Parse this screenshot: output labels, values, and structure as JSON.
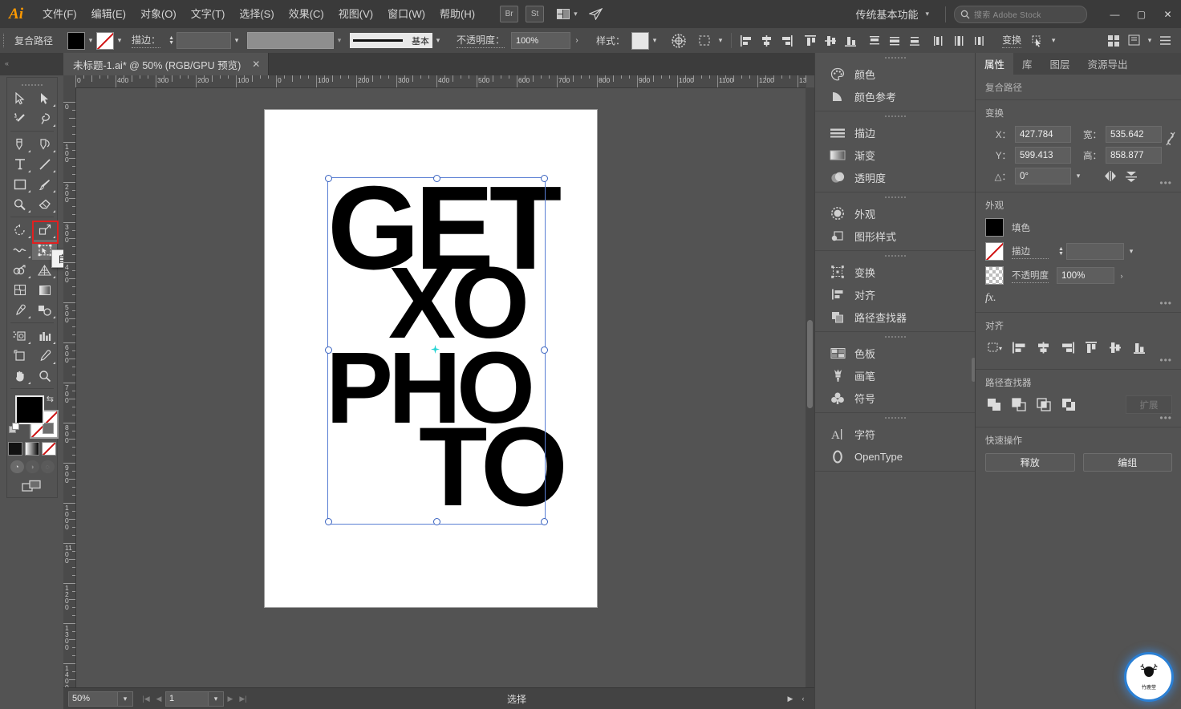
{
  "app": {
    "logo": "Ai",
    "menus": [
      "文件(F)",
      "编辑(E)",
      "对象(O)",
      "文字(T)",
      "选择(S)",
      "效果(C)",
      "视图(V)",
      "窗口(W)",
      "帮助(H)"
    ],
    "app_shortcuts": [
      "Br",
      "St"
    ],
    "workspace": "传统基本功能",
    "search_placeholder": "搜索 Adobe Stock",
    "window_buttons": [
      "minimize",
      "maximize",
      "close"
    ]
  },
  "control_bar": {
    "object_type": "复合路径",
    "fill_swatch": "#000000",
    "stroke_swatch": "none",
    "stroke_label": "描边：",
    "stroke_weight": "",
    "stroke_profile": "",
    "brush_definition": "基本",
    "opacity_label": "不透明度：",
    "opacity_value": "100%",
    "style_label": "样式：",
    "style_swatch": "#d9d9d9",
    "transform_label": "变换",
    "align_icons": [
      "align-left-icon",
      "align-center-h-icon",
      "align-right-icon",
      "align-top-icon",
      "align-center-v-icon",
      "align-bottom-icon",
      "distribute-top-icon",
      "distribute-center-v-icon",
      "distribute-bottom-icon",
      "distribute-left-icon",
      "distribute-center-h-icon",
      "distribute-right-icon"
    ]
  },
  "tab_bar": {
    "document_tab": "未标题-1.ai* @ 50% (RGB/GPU 预览)",
    "close_glyph": "✕"
  },
  "toolbar": {
    "tools": [
      [
        "selection-tool",
        "direct-selection-tool"
      ],
      [
        "magic-wand-tool",
        "lasso-tool"
      ],
      [
        "pen-tool",
        "curvature-tool"
      ],
      [
        "type-tool",
        "line-segment-tool"
      ],
      [
        "rectangle-tool",
        "paintbrush-tool"
      ],
      [
        "shaper-tool",
        "eraser-tool"
      ],
      [
        "rotate-tool",
        "scale-tool"
      ],
      [
        "width-tool",
        "free-transform-tool"
      ],
      [
        "shape-builder-tool",
        "perspective-grid-tool"
      ],
      [
        "mesh-tool",
        "gradient-tool"
      ],
      [
        "eyedropper-tool",
        "blend-tool"
      ],
      [
        "symbol-sprayer-tool",
        "column-graph-tool"
      ],
      [
        "artboard-tool",
        "slice-tool"
      ],
      [
        "hand-tool",
        "zoom-tool"
      ]
    ],
    "selected_tool": "free-transform-tool",
    "fill_color": "#000000",
    "stroke_color": "none",
    "color_modes": [
      "solid-color",
      "gradient",
      "none"
    ],
    "draw_modes": [
      "draw-normal",
      "draw-behind",
      "draw-inside"
    ],
    "screen_mode": "change-screen-mode"
  },
  "tool_flyout": {
    "items": [
      "constrain-tool",
      "free-transform-tool",
      "perspective-distort-tool",
      "free-distort-tool"
    ],
    "selected_index": 1
  },
  "tooltip": {
    "text": "自由变换工具 (E)"
  },
  "canvas": {
    "ruler_h_labels": [
      "0",
      "400",
      "300",
      "200",
      "100",
      "0",
      "100",
      "200",
      "300",
      "400",
      "500",
      "600",
      "700",
      "800",
      "900",
      "1000",
      "1100",
      "1200",
      "130"
    ],
    "ruler_v_labels": [
      "0",
      "100",
      "200",
      "300",
      "400",
      "500",
      "600",
      "700",
      "800",
      "900",
      "1000",
      "1100",
      "1200",
      "1300",
      "1400"
    ],
    "artwork_lines": [
      "GET",
      "XO",
      "PHO",
      "TO"
    ],
    "artwork_color": "#000000",
    "artboard_background": "#ffffff",
    "selection_color": "#5a7fd4"
  },
  "status_bar": {
    "zoom": "50%",
    "page": "1",
    "status": "选择"
  },
  "dock": {
    "groups": [
      {
        "items": [
          {
            "icon": "color-palette-icon",
            "label": "颜色"
          },
          {
            "icon": "color-guide-icon",
            "label": "颜色参考"
          }
        ]
      },
      {
        "items": [
          {
            "icon": "stroke-icon",
            "label": "描边"
          },
          {
            "icon": "gradient-icon",
            "label": "渐变"
          },
          {
            "icon": "transparency-icon",
            "label": "透明度"
          }
        ]
      },
      {
        "items": [
          {
            "icon": "appearance-icon",
            "label": "外观"
          },
          {
            "icon": "graphic-styles-icon",
            "label": "图形样式"
          }
        ]
      },
      {
        "items": [
          {
            "icon": "transform-icon",
            "label": "变换"
          },
          {
            "icon": "align-icon",
            "label": "对齐"
          },
          {
            "icon": "pathfinder-icon",
            "label": "路径查找器"
          }
        ]
      },
      {
        "items": [
          {
            "icon": "swatches-icon",
            "label": "色板"
          },
          {
            "icon": "brushes-icon",
            "label": "画笔"
          },
          {
            "icon": "symbols-icon",
            "label": "符号"
          }
        ]
      },
      {
        "items": [
          {
            "icon": "character-icon",
            "label": "字符"
          },
          {
            "icon": "opentype-icon",
            "label": "OpenType"
          }
        ]
      }
    ]
  },
  "properties": {
    "tabs": [
      "属性",
      "库",
      "图层",
      "资源导出"
    ],
    "active_tab": "属性",
    "object_label": "复合路径",
    "transform": {
      "title": "变换",
      "x_label": "X：",
      "x_value": "427.784",
      "y_label": "Y：",
      "y_value": "599.413",
      "w_label": "宽：",
      "w_value": "535.642",
      "h_label": "高：",
      "h_value": "858.877",
      "angle_label": "△：",
      "angle_value": "0°",
      "link_icon": "constrain-proportions-icon",
      "flip_icons": [
        "flip-horizontal-icon",
        "flip-vertical-icon"
      ],
      "more_icon": "more-options-icon"
    },
    "appearance": {
      "title": "外观",
      "fill_label": "填色",
      "fill_color": "#000000",
      "stroke_label": "描边",
      "stroke_color": "none",
      "stroke_weight": "",
      "opacity_label": "不透明度",
      "opacity_value": "100%",
      "fx_label": "fx."
    },
    "align": {
      "title": "对齐",
      "icons": [
        "align-to-selection-icon",
        "align-left-icon",
        "align-center-h-icon",
        "align-right-icon",
        "align-top-icon",
        "align-center-v-icon",
        "align-bottom-icon"
      ]
    },
    "pathfinder": {
      "title": "路径查找器",
      "icons": [
        "unite-icon",
        "minus-front-icon",
        "intersect-icon",
        "exclude-icon"
      ],
      "expand_label": "扩展"
    },
    "quick_actions": {
      "title": "快速操作",
      "buttons": [
        "释放",
        "编组"
      ]
    }
  },
  "watermark": {
    "label": "竹鹿堂",
    "icon": "deer-logo-icon"
  }
}
